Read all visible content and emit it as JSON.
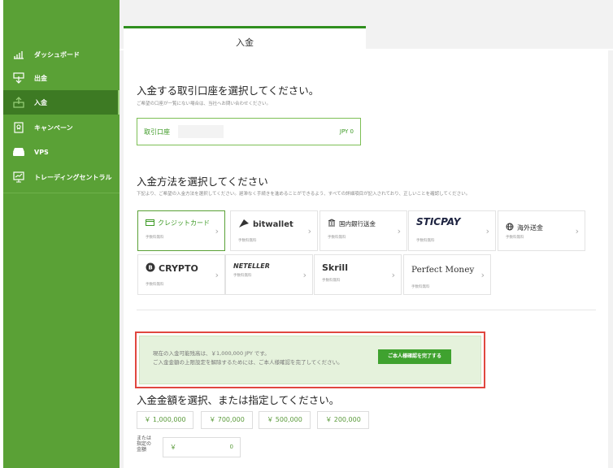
{
  "sidebar": {
    "items": [
      {
        "label": "ダッシュボード",
        "icon": "bar-chart-icon"
      },
      {
        "label": "出金",
        "icon": "withdraw-icon"
      },
      {
        "label": "入金",
        "icon": "deposit-icon",
        "active": true
      },
      {
        "label": "キャンペーン",
        "icon": "campaign-icon"
      },
      {
        "label": "VPS",
        "icon": "server-icon"
      },
      {
        "label": "トレーディングセントラル",
        "icon": "monitor-icon"
      }
    ]
  },
  "tab": {
    "label": "入金"
  },
  "account_section": {
    "title": "入金する取引口座を選択してください。",
    "subtitle": "ご希望の口座が一覧にない場合は、当社へお問い合わせください。",
    "account_label": "取引口座",
    "balance": "JPY 0"
  },
  "method_section": {
    "title": "入金方法を選択してください",
    "subtitle": "下記より、ご希望の入金方法を選択してください。遅滞なく手続きを進めることができるよう、すべての詳細項目が記入されており、正しいことを確認してください。",
    "fee_label": "手数料無料",
    "methods": [
      {
        "label": "クレジットカード",
        "icon": "credit-card-icon"
      },
      {
        "label": "bitwallet",
        "icon": "bitwallet-icon"
      },
      {
        "label": "国内銀行送金",
        "icon": "bank-icon"
      },
      {
        "label": "STICPAY",
        "icon": ""
      },
      {
        "label": "海外送金",
        "icon": "globe-icon"
      },
      {
        "label": "CRYPTO",
        "icon": "bitcoin-icon"
      },
      {
        "label": "NETELLER",
        "icon": ""
      },
      {
        "label": "Skrill",
        "icon": ""
      },
      {
        "label": "Perfect Money",
        "icon": ""
      }
    ]
  },
  "notice": {
    "line1": "現在の入金可能残高は、￥1,000,000 JPY です。",
    "line2": "ご入金金額の上限設定を解除するためには、ご本人様確認を完了してください。",
    "button": "ご本人様確認を完了する"
  },
  "amount_section": {
    "title": "入金金額を選択、または指定してください。",
    "presets": [
      "￥ 1,000,000",
      "￥ 700,000",
      "￥ 500,000",
      "￥ 200,000"
    ],
    "or_label": "または 指定の 金額",
    "currency": "￥",
    "value": "0"
  },
  "colors": {
    "sidebar_bg": "#5aa136",
    "sidebar_active": "#3d7a23",
    "accent": "#3fa22f",
    "notice_bg": "#e5f2dc",
    "highlight_border": "#e0473f"
  }
}
